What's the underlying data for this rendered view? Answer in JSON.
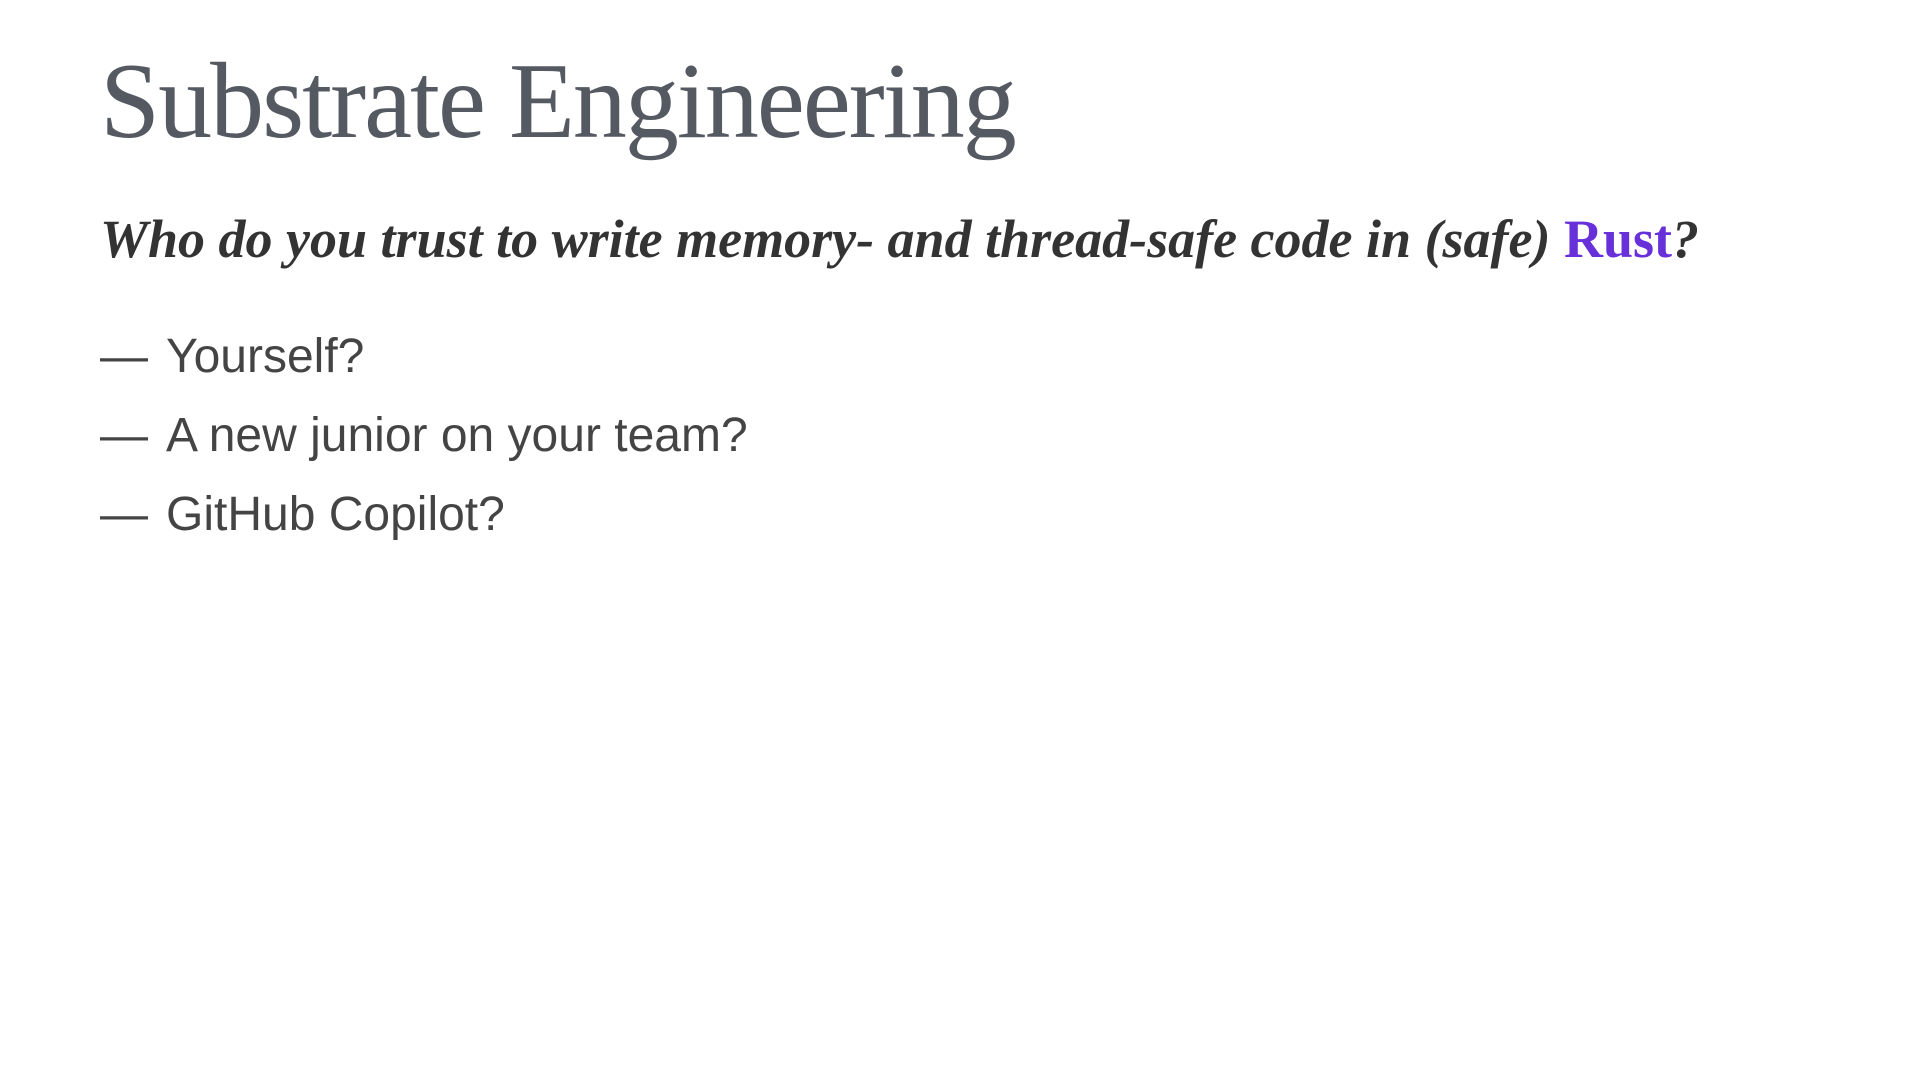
{
  "slide": {
    "title": "Substrate Engineering",
    "question_prefix": "Who do you trust to write memory- and thread-safe code in (safe) ",
    "question_highlight": "Rust",
    "question_suffix": "?",
    "bullets": [
      "Yourself?",
      "A new junior on your team?",
      "GitHub Copilot?"
    ]
  }
}
